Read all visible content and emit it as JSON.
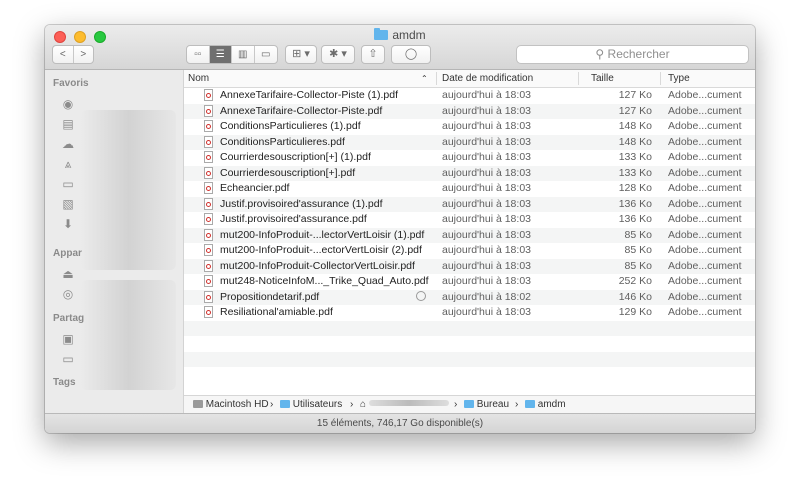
{
  "window": {
    "title": "amdm"
  },
  "toolbar": {
    "back_label": "<",
    "forward_label": ">",
    "view_icons": [
      "icon-view-icon",
      "list-view-icon",
      "column-view-icon",
      "coverflow-view-icon"
    ],
    "arrange_label": "⊞ ▾",
    "action_label": "✱ ▾",
    "search_placeholder": "Rechercher"
  },
  "sidebar": {
    "favorites_title": "Favoris",
    "devices_title": "Appar",
    "shared_title": "Partag",
    "tags_title": "Tags"
  },
  "columns": {
    "name": "Nom",
    "date": "Date de modification",
    "size": "Taille",
    "type": "Type"
  },
  "files": [
    {
      "name": "AnnexeTarifaire-Collector-Piste (1).pdf",
      "date": "aujourd'hui à 18:03",
      "size": "127 Ko",
      "type": "Adobe...cument"
    },
    {
      "name": "AnnexeTarifaire-Collector-Piste.pdf",
      "date": "aujourd'hui à 18:03",
      "size": "127 Ko",
      "type": "Adobe...cument"
    },
    {
      "name": "ConditionsParticulieres (1).pdf",
      "date": "aujourd'hui à 18:03",
      "size": "148 Ko",
      "type": "Adobe...cument"
    },
    {
      "name": "ConditionsParticulieres.pdf",
      "date": "aujourd'hui à 18:03",
      "size": "148 Ko",
      "type": "Adobe...cument"
    },
    {
      "name": "Courrierdesouscription[+] (1).pdf",
      "date": "aujourd'hui à 18:03",
      "size": "133 Ko",
      "type": "Adobe...cument"
    },
    {
      "name": "Courrierdesouscription[+].pdf",
      "date": "aujourd'hui à 18:03",
      "size": "133 Ko",
      "type": "Adobe...cument"
    },
    {
      "name": "Echeancier.pdf",
      "date": "aujourd'hui à 18:03",
      "size": "128 Ko",
      "type": "Adobe...cument"
    },
    {
      "name": "Justif.provisoired'assurance (1).pdf",
      "date": "aujourd'hui à 18:03",
      "size": "136 Ko",
      "type": "Adobe...cument"
    },
    {
      "name": "Justif.provisoired'assurance.pdf",
      "date": "aujourd'hui à 18:03",
      "size": "136 Ko",
      "type": "Adobe...cument"
    },
    {
      "name": "mut200-InfoProduit-...lectorVertLoisir (1).pdf",
      "date": "aujourd'hui à 18:03",
      "size": "85 Ko",
      "type": "Adobe...cument"
    },
    {
      "name": "mut200-InfoProduit-...ectorVertLoisir (2).pdf",
      "date": "aujourd'hui à 18:03",
      "size": "85 Ko",
      "type": "Adobe...cument"
    },
    {
      "name": "mut200-InfoProduit-CollectorVertLoisir.pdf",
      "date": "aujourd'hui à 18:03",
      "size": "85 Ko",
      "type": "Adobe...cument"
    },
    {
      "name": "mut248-NoticeInfoM..._Trike_Quad_Auto.pdf",
      "date": "aujourd'hui à 18:03",
      "size": "252 Ko",
      "type": "Adobe...cument"
    },
    {
      "name": "Propositiondetarif.pdf",
      "date": "aujourd'hui à 18:02",
      "size": "146 Ko",
      "type": "Adobe...cument"
    },
    {
      "name": "Resiliational'amiable.pdf",
      "date": "aujourd'hui à 18:03",
      "size": "129 Ko",
      "type": "Adobe...cument"
    }
  ],
  "pathbar": {
    "items": [
      "Macintosh HD",
      "Utilisateurs",
      "Bureau",
      "amdm"
    ]
  },
  "status": "15 éléments, 746,17 Go disponible(s)"
}
